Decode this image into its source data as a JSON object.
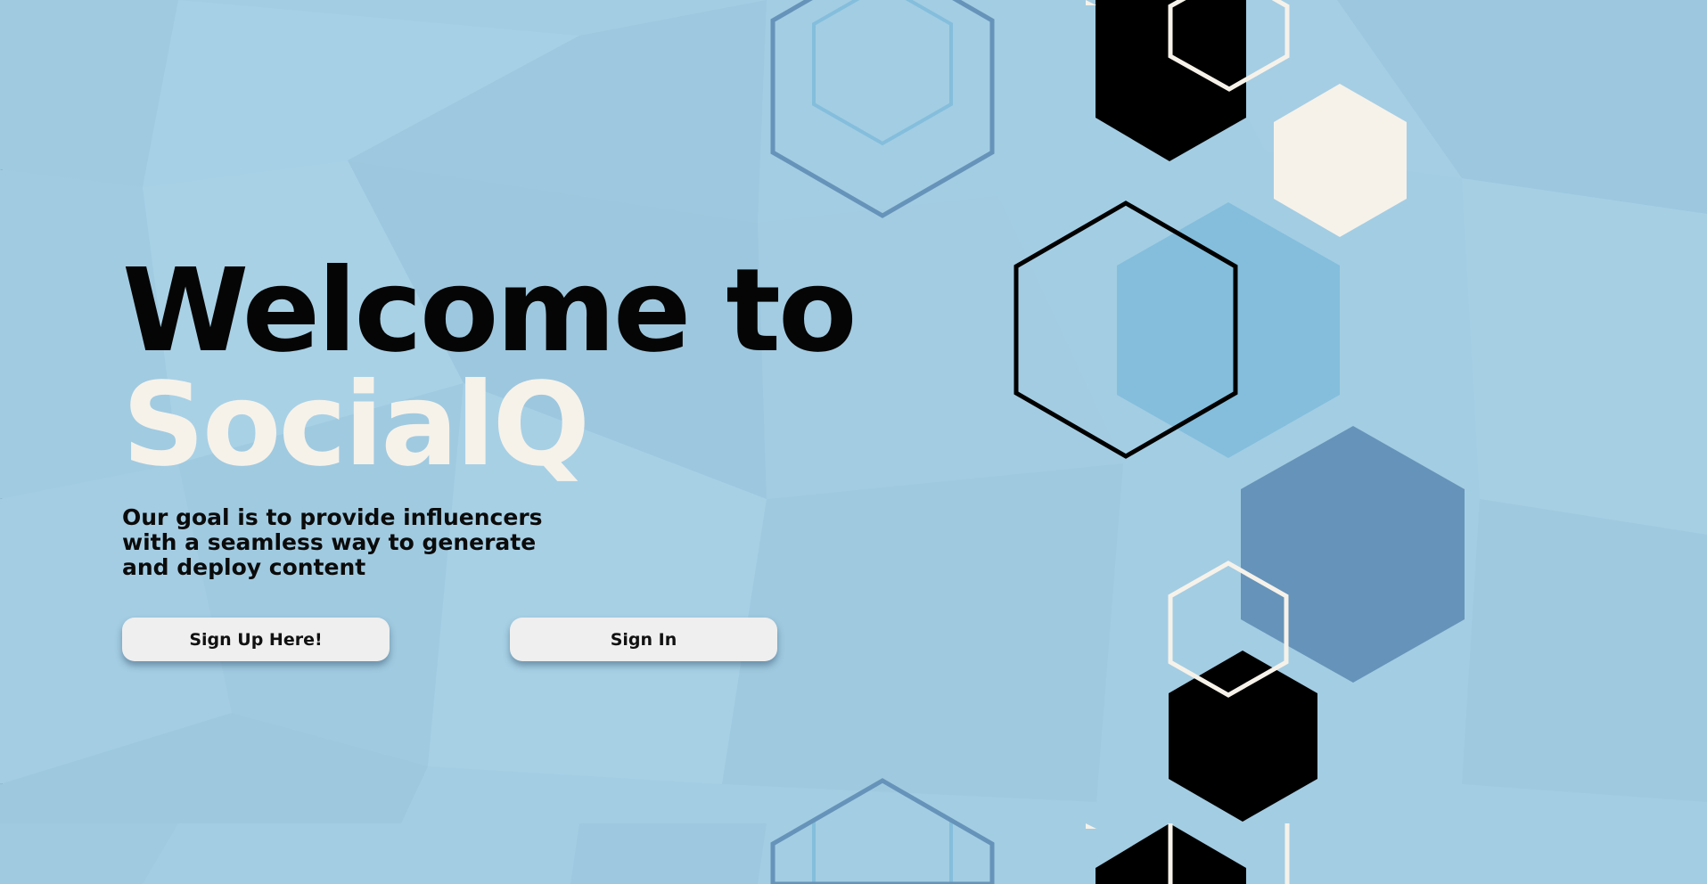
{
  "hero": {
    "title_line1": "Welcome to",
    "title_line2": "SocialQ",
    "tagline": "Our goal is to provide influencers with a seamless way to generate and deploy content"
  },
  "actions": {
    "signup_label": "Sign Up Here!",
    "signin_label": "Sign In"
  },
  "colors": {
    "background": "#a3cde3",
    "title_dark": "#050505",
    "title_light": "#f6f2ea",
    "button_bg": "#efefef",
    "hex_steel": "#6693b9",
    "hex_sky": "#84bedc",
    "hex_black": "#000000",
    "hex_cream": "#f6f2ea"
  },
  "decor": {
    "icons": [
      "hexagon-icon"
    ]
  }
}
